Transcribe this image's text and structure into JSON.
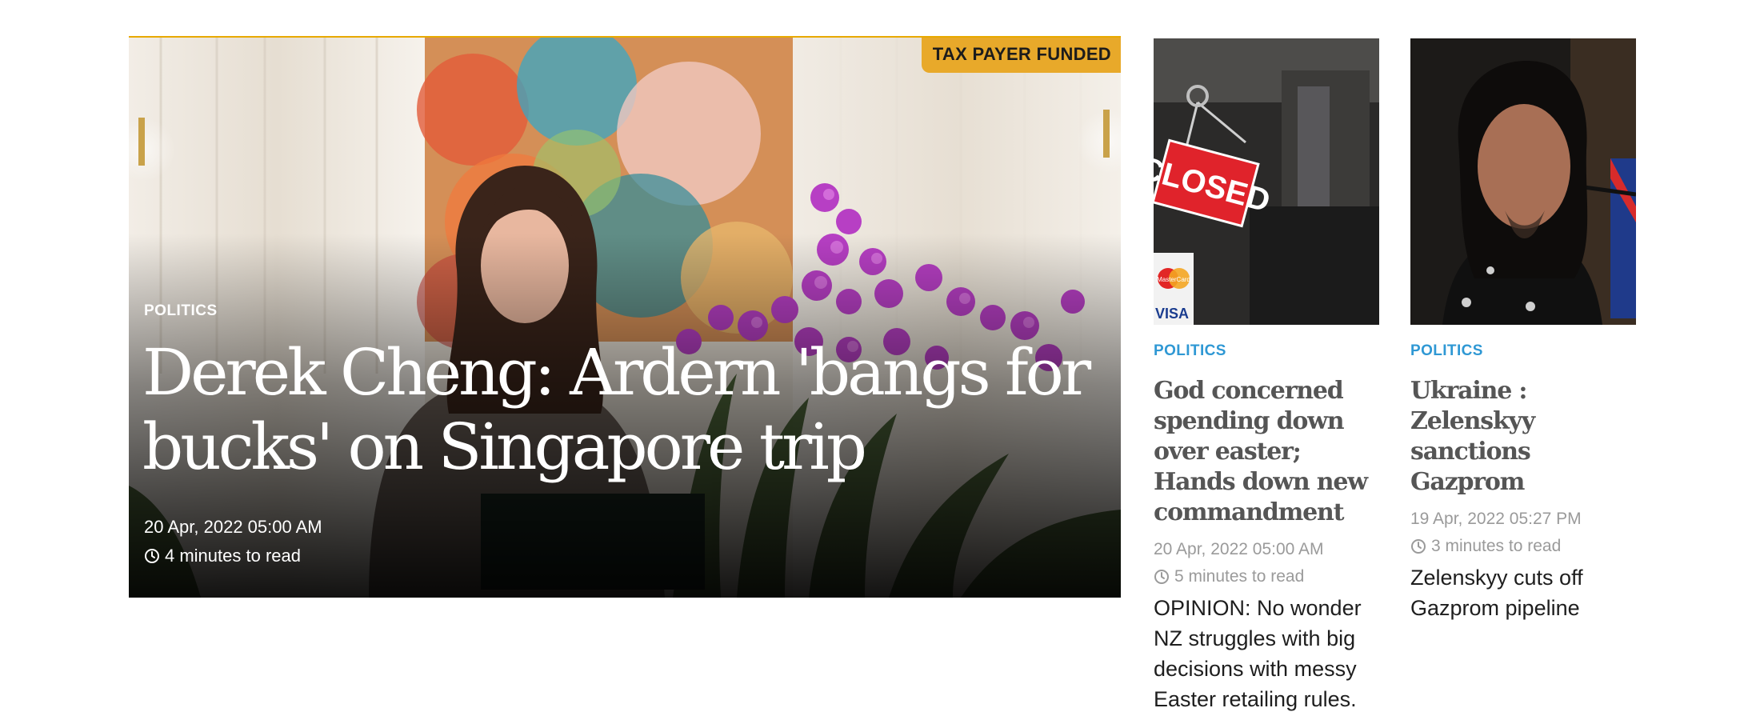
{
  "hero": {
    "badge": "TAX PAYER FUNDED",
    "category": "POLITICS",
    "title": "Derek Cheng: Ardern 'bangs for bucks' on Singapore trip",
    "date": "20 Apr, 2022 05:00 AM",
    "read_time": "4 minutes to read",
    "badge_color": "#e8a92a"
  },
  "cards": [
    {
      "category": "POLITICS",
      "title": "God concerned spending down over easter; Hands down new commandment",
      "date": "20 Apr, 2022 05:00 AM",
      "read_time": "5 minutes to read",
      "summary": "OPINION: No wonder NZ struggles with big decisions with messy Easter retailing rules.",
      "image_text": {
        "sign": "CLOSED",
        "card_top": "MasterCard",
        "card_bottom": "VISA"
      }
    },
    {
      "category": "POLITICS",
      "title": "Ukraine : Zelenskyy sanctions Gazprom",
      "date": "19 Apr, 2022 05:27 PM",
      "read_time": "3 minutes to read",
      "summary": "Zelenskyy cuts off Gazprom pipeline"
    }
  ],
  "colors": {
    "category_blue": "#2f98d4",
    "title_gray": "#555555",
    "meta_gray": "#9a9a9a"
  },
  "icons": {
    "read_time": "clock-icon"
  }
}
